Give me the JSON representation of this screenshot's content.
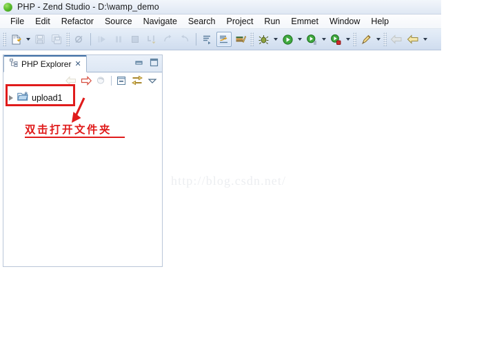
{
  "window": {
    "title": "PHP - Zend Studio - D:\\wamp_demo",
    "logo_icon": "zend-green-orb-icon"
  },
  "menubar": {
    "items": [
      {
        "label": "File"
      },
      {
        "label": "Edit"
      },
      {
        "label": "Refactor"
      },
      {
        "label": "Source"
      },
      {
        "label": "Navigate"
      },
      {
        "label": "Search"
      },
      {
        "label": "Project"
      },
      {
        "label": "Run"
      },
      {
        "label": "Emmet"
      },
      {
        "label": "Window"
      },
      {
        "label": "Help"
      }
    ]
  },
  "toolbar": {
    "groups": [
      {
        "buttons": [
          {
            "icon": "new-file-icon",
            "dropdown": true,
            "enabled": true
          },
          {
            "icon": "save-icon",
            "dropdown": false,
            "enabled": false
          },
          {
            "icon": "save-all-icon",
            "dropdown": false,
            "enabled": false
          }
        ]
      },
      {
        "buttons": [
          {
            "icon": "toggle-breakpoint-icon",
            "dropdown": false,
            "enabled": false
          }
        ]
      },
      {
        "buttons": [
          {
            "icon": "resume-icon",
            "dropdown": false,
            "enabled": false
          },
          {
            "icon": "suspend-icon",
            "dropdown": false,
            "enabled": false
          },
          {
            "icon": "terminate-icon",
            "dropdown": false,
            "enabled": false
          },
          {
            "icon": "step-into-icon",
            "dropdown": false,
            "enabled": false
          },
          {
            "icon": "step-over-icon",
            "dropdown": false,
            "enabled": false
          },
          {
            "icon": "step-return-icon",
            "dropdown": false,
            "enabled": false
          },
          {
            "icon": "step-out-icon",
            "dropdown": false,
            "enabled": false
          }
        ]
      },
      {
        "buttons": [
          {
            "icon": "open-task-icon",
            "dropdown": false,
            "enabled": true
          },
          {
            "icon": "open-php-type-icon",
            "dropdown": false,
            "enabled": true,
            "pressed": true
          },
          {
            "icon": "open-resource-icon",
            "dropdown": false,
            "enabled": true
          }
        ]
      },
      {
        "buttons": [
          {
            "icon": "debug-bug-icon",
            "dropdown": true,
            "enabled": true
          },
          {
            "icon": "run-play-icon",
            "dropdown": true,
            "enabled": true
          },
          {
            "icon": "run-as-server-icon",
            "dropdown": true,
            "enabled": true
          },
          {
            "icon": "profile-icon",
            "dropdown": true,
            "enabled": true
          },
          {
            "icon": "external-tools-icon",
            "dropdown": true,
            "enabled": true
          }
        ]
      },
      {
        "buttons": [
          {
            "icon": "back-navigate-icon",
            "dropdown": false,
            "enabled": false
          },
          {
            "icon": "forward-navigate-icon",
            "dropdown": true,
            "enabled": true
          }
        ]
      }
    ]
  },
  "explorer": {
    "tab": {
      "icon": "php-explorer-tree-icon",
      "label": "PHP Explorer",
      "close_glyph": "✕"
    },
    "window_buttons": [
      {
        "icon": "minimize-icon"
      },
      {
        "icon": "maximize-icon"
      }
    ],
    "view_toolbar": [
      {
        "icon": "back-arrow-icon",
        "enabled": false
      },
      {
        "icon": "forward-arrow-icon",
        "enabled": true
      },
      {
        "icon": "refresh-icon",
        "enabled": false
      },
      {
        "icon": "collapse-all-icon",
        "enabled": true
      },
      {
        "icon": "link-with-editor-icon",
        "enabled": true
      },
      {
        "icon": "view-menu-chevron-icon",
        "enabled": true
      }
    ],
    "tree": [
      {
        "label": "upload1",
        "icon": "php-project-folder-icon",
        "expander": "collapsed-triangle-icon"
      }
    ]
  },
  "editor": {
    "watermark": "http://blog.csdn.net/"
  },
  "annotations": {
    "highlight_box": {
      "target": "upload1",
      "color": "#e01b1b"
    },
    "arrow": {
      "color": "#e01b1b"
    },
    "note_text": "双击打开文件夹",
    "note_color": "#e01b1b"
  }
}
